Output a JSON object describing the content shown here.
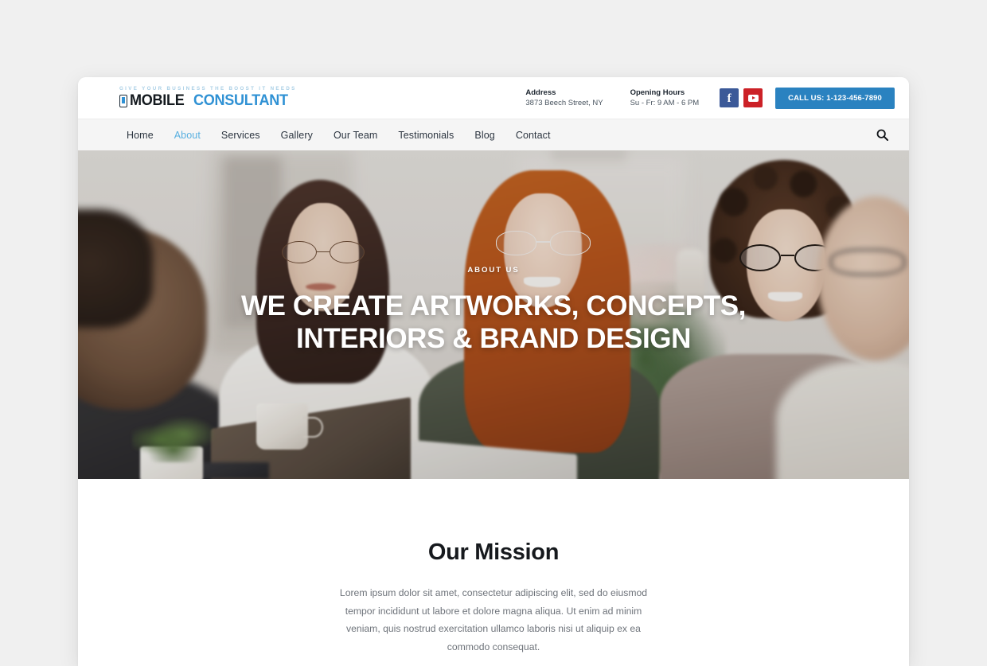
{
  "header": {
    "logo": {
      "tagline": "GIVE YOUR BUSINESS THE BOOST IT NEEDS",
      "word_primary": "MOBILE",
      "word_secondary": "CONSULTANT",
      "icon": "mobile-phone-icon",
      "color_primary": "#141a1f",
      "color_secondary": "#2f91d4",
      "tagline_color": "#a9cfe6"
    },
    "address": {
      "label": "Address",
      "value": "3873 Beech Street, NY"
    },
    "hours": {
      "label": "Opening Hours",
      "value": "Su - Fr: 9 AM - 6 PM"
    },
    "social": [
      {
        "name": "facebook",
        "glyph": "f",
        "color": "#3b5998"
      },
      {
        "name": "youtube",
        "glyph": "play",
        "color": "#cc2127"
      }
    ],
    "cta": {
      "label": "CALL US: 1-123-456-7890",
      "color": "#2a82c0"
    }
  },
  "nav": {
    "items": [
      {
        "label": "Home",
        "active": false
      },
      {
        "label": "About",
        "active": true
      },
      {
        "label": "Services",
        "active": false
      },
      {
        "label": "Gallery",
        "active": false
      },
      {
        "label": "Our Team",
        "active": false
      },
      {
        "label": "Testimonials",
        "active": false
      },
      {
        "label": "Blog",
        "active": false
      },
      {
        "label": "Contact",
        "active": false
      }
    ],
    "active_color": "#59b0e0",
    "search_icon": "search-icon"
  },
  "hero": {
    "eyebrow": "ABOUT US",
    "title_line1": "WE CREATE ARTWORKS, CONCEPTS,",
    "title_line2": "INTERIORS & BRAND DESIGN",
    "image_description": "Four colleagues smiling around a meeting table in a bright office"
  },
  "mission": {
    "title": "Our Mission",
    "body": "Lorem ipsum dolor sit amet, consectetur adipiscing elit, sed do eiusmod tempor incididunt ut labore et dolore magna aliqua. Ut enim ad minim veniam, quis nostrud exercitation ullamco laboris nisi ut aliquip ex ea commodo consequat."
  }
}
